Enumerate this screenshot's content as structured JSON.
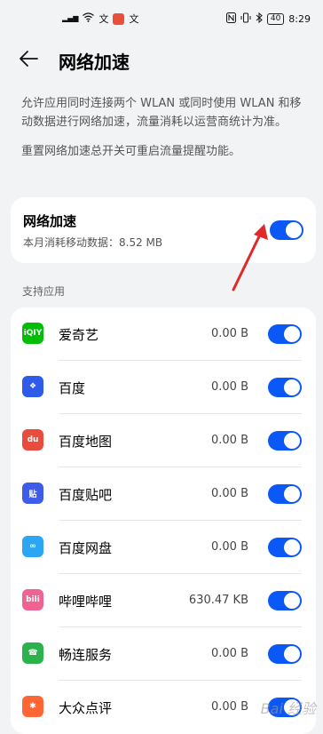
{
  "statusbar": {
    "left_text": "文",
    "left_text2": "文",
    "battery": "40",
    "time": "8:29"
  },
  "header": {
    "title": "网络加速"
  },
  "description": {
    "line1": "允许应用同时连接两个 WLAN 或同时使用 WLAN 和移动数据进行网络加速，流量消耗以运营商统计为准。",
    "line2": "重置网络加速总开关可重启流量提醒功能。"
  },
  "main_card": {
    "title": "网络加速",
    "subtitle": "本月消耗移动数据：8.52 MB",
    "enabled": true
  },
  "section": {
    "label": "支持应用"
  },
  "apps": [
    {
      "name": "爱奇艺",
      "value": "0.00 B",
      "icon": "iqiyi-icon",
      "color": "#00be06",
      "glyph": "iQIY",
      "enabled": true
    },
    {
      "name": "百度",
      "value": "0.00 B",
      "icon": "baidu-paw-icon",
      "color": "#2f5bea",
      "glyph": "❖",
      "enabled": true
    },
    {
      "name": "百度地图",
      "value": "0.00 B",
      "icon": "baidu-map-icon",
      "color": "#e94b3c",
      "glyph": "du",
      "enabled": true
    },
    {
      "name": "百度贴吧",
      "value": "0.00 B",
      "icon": "tieba-icon",
      "color": "#3e5bea",
      "glyph": "贴",
      "enabled": true
    },
    {
      "name": "百度网盘",
      "value": "0.00 B",
      "icon": "baidu-netdisk-icon",
      "color": "#2aa6f2",
      "glyph": "∞",
      "enabled": true
    },
    {
      "name": "哔哩哔哩",
      "value": "630.47 KB",
      "icon": "bilibili-icon",
      "color": "#f06292",
      "glyph": "bili",
      "enabled": true
    },
    {
      "name": "畅连服务",
      "value": "0.00 B",
      "icon": "changlian-icon",
      "color": "#2bb24c",
      "glyph": "☎",
      "enabled": true
    },
    {
      "name": "大众点评",
      "value": "0.00 B",
      "icon": "dianping-icon",
      "color": "#ff6633",
      "glyph": "✱",
      "enabled": true
    }
  ],
  "watermark": "Bai 经验",
  "colors": {
    "accent": "#0a59f7",
    "arrow": "#e0292b"
  }
}
